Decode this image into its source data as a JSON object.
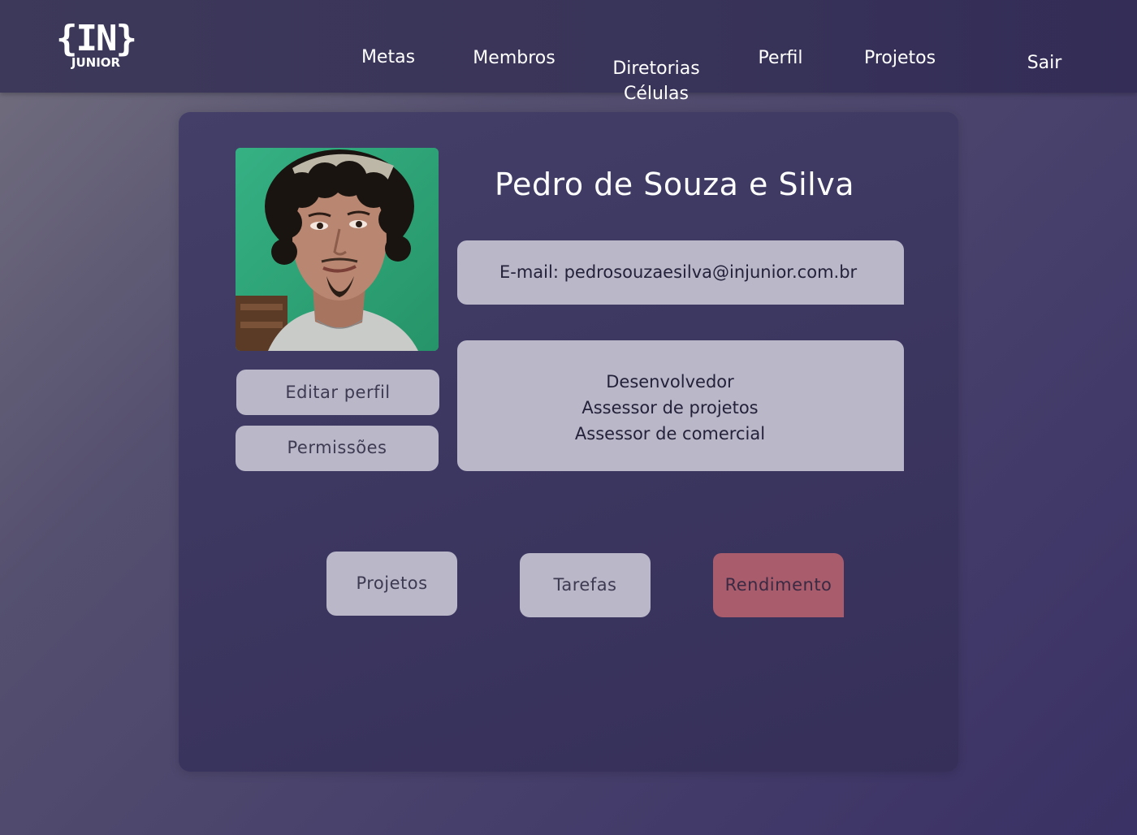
{
  "header": {
    "logo": {
      "main": "{IN}",
      "sub": "JUNIOR"
    },
    "nav": [
      {
        "label": "Metas"
      },
      {
        "label": "Membros"
      },
      {
        "label": "Diretorias\nCélulas"
      },
      {
        "label": "Perfil"
      },
      {
        "label": "Projetos"
      }
    ],
    "logout_label": "Sair"
  },
  "profile": {
    "name": "Pedro de Souza e Silva",
    "email_text": "E-mail: pedrosouzaesilva@injunior.com.br",
    "roles": [
      "Desenvolvedor",
      "Assessor de projetos",
      "Assessor de comercial"
    ],
    "edit_button": "Editar perfil",
    "permissions_button": "Permissões"
  },
  "tabs": [
    {
      "label": "Projetos",
      "active": false
    },
    {
      "label": "Tarefas",
      "active": false
    },
    {
      "label": "Rendimento",
      "active": true
    }
  ],
  "colors": {
    "accent": "#a95c6b",
    "button_bg": "#b9b7c8",
    "card_bg": "#3e3963"
  }
}
